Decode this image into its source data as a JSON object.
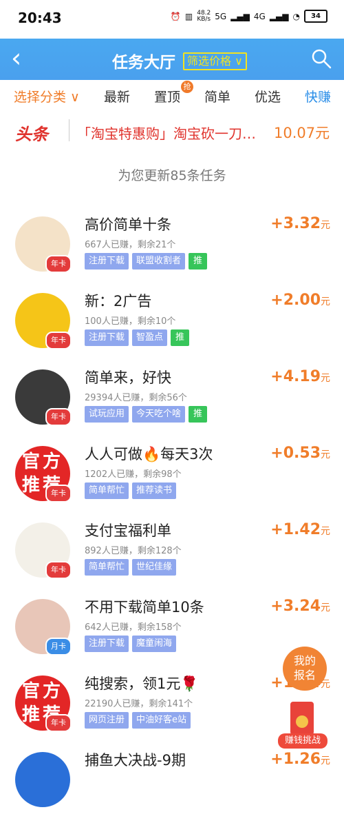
{
  "status": {
    "time": "20:43",
    "speed": "48.2",
    "speed_unit": "KB/s",
    "net1": "5G",
    "net2": "4G",
    "battery": "34"
  },
  "header": {
    "title": "任务大厅",
    "filter_label": "筛选价格",
    "filter_caret": "∨"
  },
  "tabs": [
    {
      "label": "选择分类 ∨"
    },
    {
      "label": "最新"
    },
    {
      "label": "置顶"
    },
    {
      "label": "简单"
    },
    {
      "label": "优选"
    },
    {
      "label": "快赚"
    }
  ],
  "hot_badge": "抢",
  "news": {
    "tag": "头条",
    "text": "「淘宝特惠购」淘宝砍一刀…",
    "amount": "10.07元"
  },
  "update_text": "为您更新85条任务",
  "tasks": [
    {
      "title": "高价简单十条",
      "meta": "667人已赚，剩余21个",
      "tags": [
        "注册下载",
        "联盟收割者"
      ],
      "push": "推",
      "reward": "+3.32",
      "unit": "元",
      "badge": "年卡"
    },
    {
      "title": "新：2广告",
      "meta": "100人已赚，剩余10个",
      "tags": [
        "注册下载",
        "智盈点"
      ],
      "push": "推",
      "reward": "+2.00",
      "unit": "元",
      "badge": "年卡"
    },
    {
      "title": "简单来，好快",
      "meta": "29394人已赚，剩余56个",
      "tags": [
        "试玩应用",
        "今天吃个啥"
      ],
      "push": "推",
      "reward": "+4.19",
      "unit": "元",
      "badge": "年卡"
    },
    {
      "title": "人人可做🔥每天3次",
      "meta": "1202人已赚，剩余98个",
      "tags": [
        "简单帮忙",
        "推荐读书"
      ],
      "push": "",
      "reward": "+0.53",
      "unit": "元",
      "badge": "年卡",
      "avatar_text": "官方推荐"
    },
    {
      "title": "支付宝福利单",
      "meta": "892人已赚，剩余128个",
      "tags": [
        "简单帮忙",
        "世纪佳缘"
      ],
      "push": "",
      "reward": "+1.42",
      "unit": "元",
      "badge": "年卡"
    },
    {
      "title": "不用下载简单10条",
      "meta": "642人已赚，剩余158个",
      "tags": [
        "注册下载",
        "魔童闹海"
      ],
      "push": "",
      "reward": "+3.24",
      "unit": "元",
      "badge": "月卡"
    },
    {
      "title": "纯搜索，领1元🌹",
      "meta": "22190人已赚，剩余141个",
      "tags": [
        "网页注册",
        "中油好客e站"
      ],
      "push": "",
      "reward": "+1.04",
      "unit": "元",
      "badge": "年卡",
      "avatar_text": "官方推荐"
    },
    {
      "title": "捕鱼大决战-9期",
      "meta": "",
      "tags": [],
      "push": "",
      "reward": "+1.26",
      "unit": "元",
      "badge": ""
    }
  ],
  "floats": {
    "my_signup": "我的报名",
    "earn_challenge": "赚钱挑战"
  },
  "colors": {
    "header": "#4aa8f0",
    "accent": "#f07d2a",
    "tag": "#8fa7ee",
    "push": "#37c55a"
  }
}
